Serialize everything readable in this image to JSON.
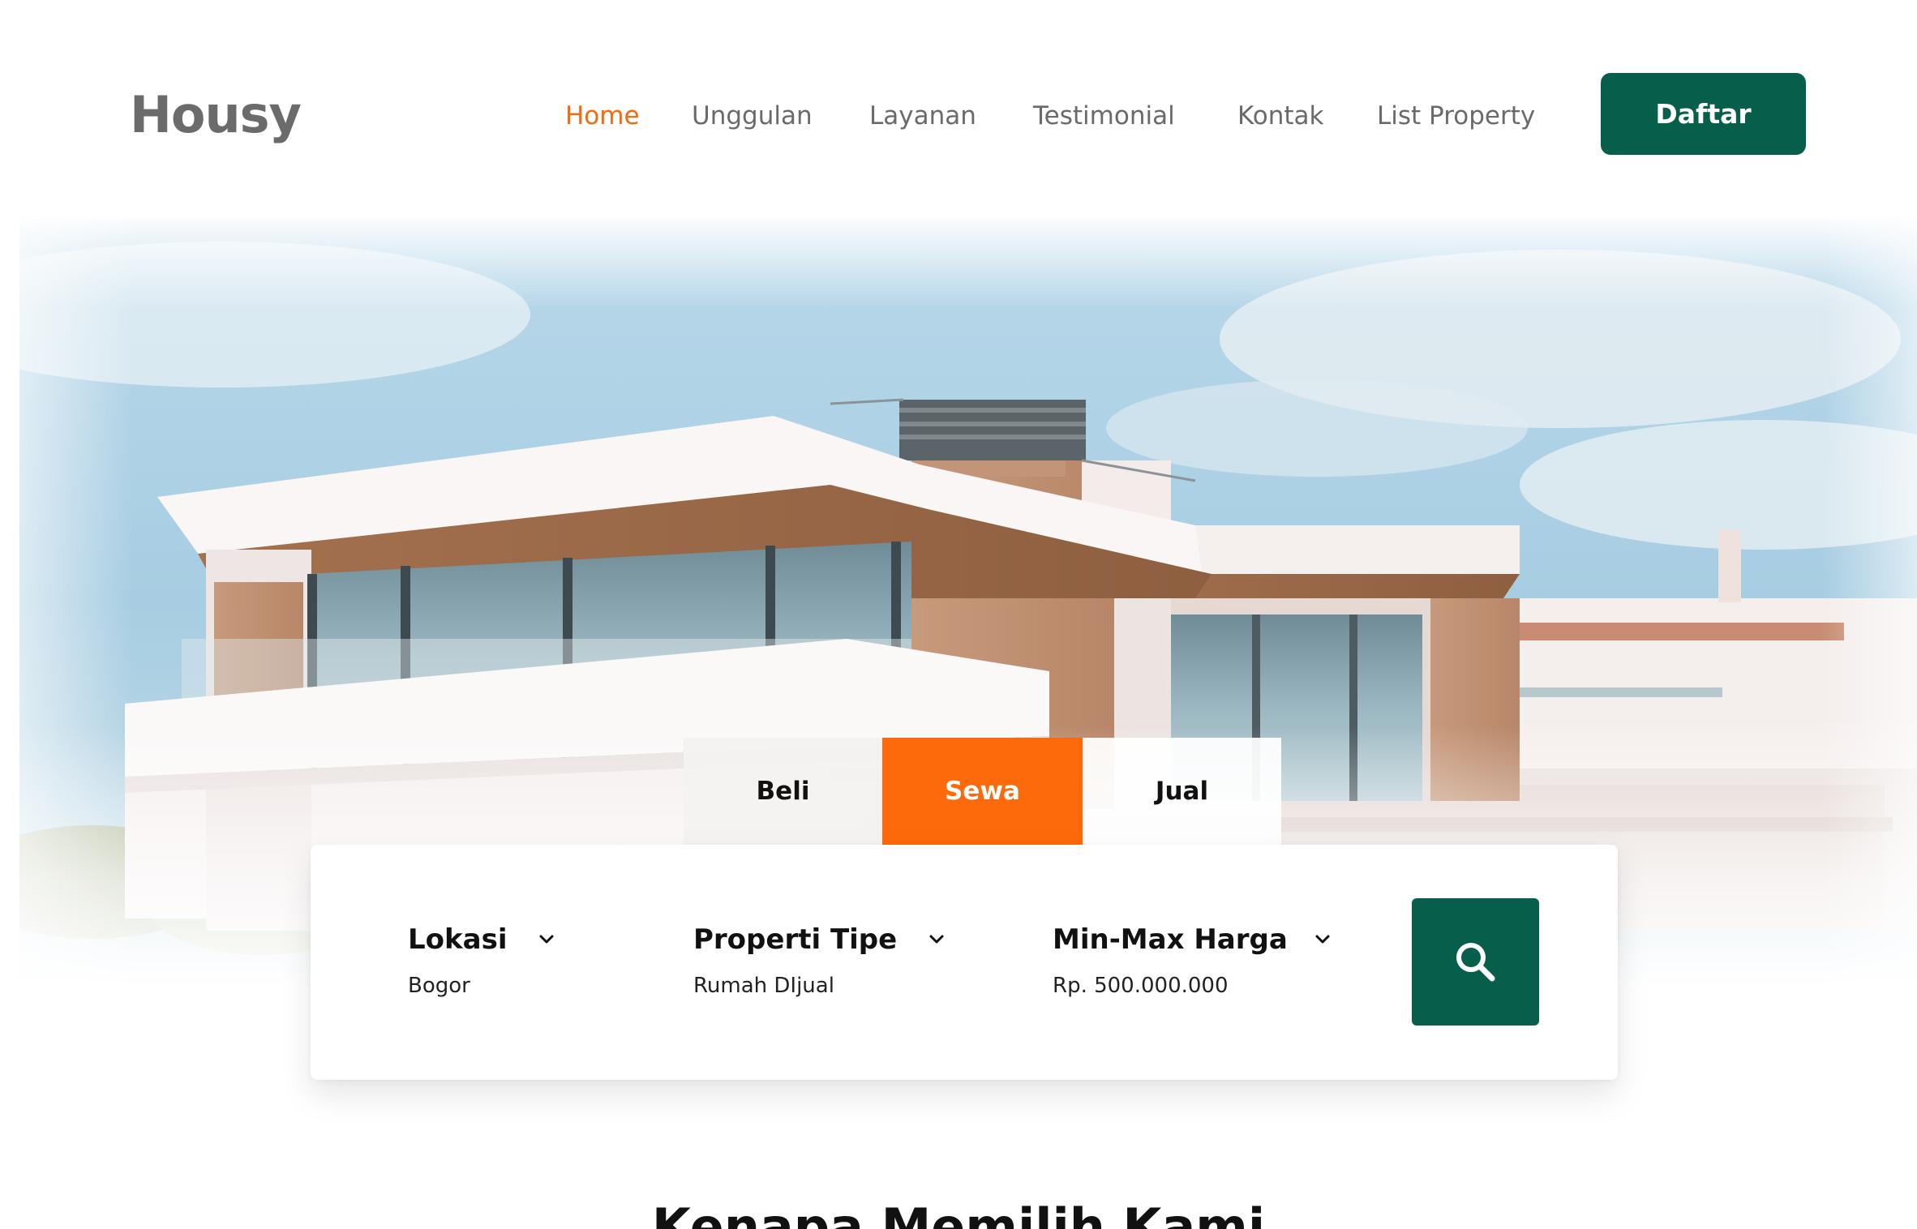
{
  "brand": {
    "name": "Housy"
  },
  "nav": {
    "items": [
      {
        "label": "Home",
        "active": true
      },
      {
        "label": "Unggulan",
        "active": false
      },
      {
        "label": "Layanan",
        "active": false
      },
      {
        "label": "Testimonial",
        "active": false
      },
      {
        "label": "Kontak",
        "active": false
      },
      {
        "label": "List Property",
        "active": false
      }
    ],
    "register_label": "Daftar"
  },
  "hero": {
    "tabs": [
      {
        "label": "Beli",
        "active": false
      },
      {
        "label": "Sewa",
        "active": true
      },
      {
        "label": "Jual",
        "active": false
      }
    ]
  },
  "search": {
    "fields": [
      {
        "label": "Lokasi",
        "value": "Bogor"
      },
      {
        "label": "Properti Tipe",
        "value": "Rumah DIjual"
      },
      {
        "label": "Min-Max Harga",
        "value": "Rp. 500.000.000"
      }
    ],
    "button_icon": "search-icon"
  },
  "section": {
    "title": "Kenapa Memilih Kami"
  },
  "colors": {
    "primary_green": "#075f4b",
    "accent_orange": "#fd6a0b",
    "nav_active": "#f26b0f",
    "nav_text": "#6a6a6a",
    "logo": "#6b6b6b"
  }
}
